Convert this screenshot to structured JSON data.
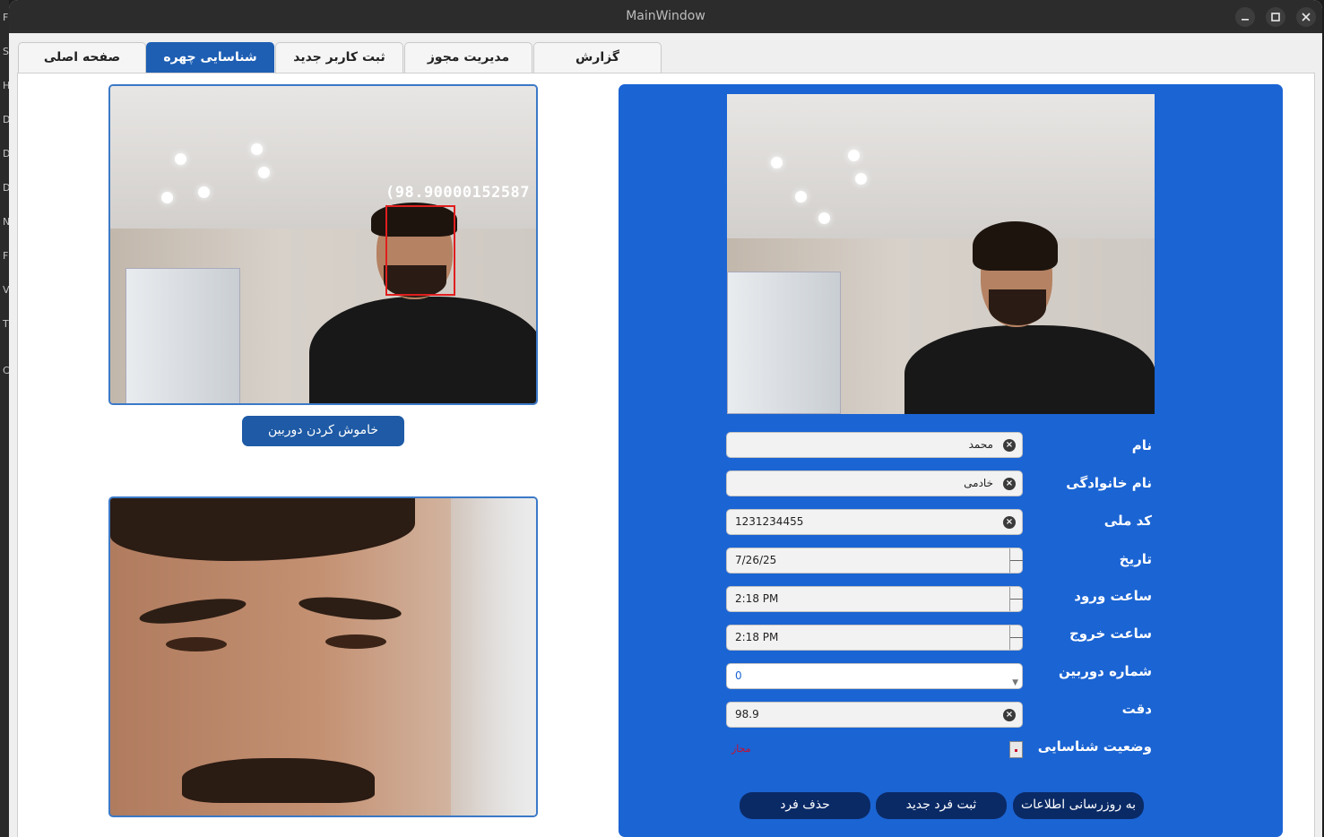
{
  "window": {
    "title": "MainWindow"
  },
  "background_letters": [
    "F",
    "S",
    "H",
    "D",
    "D",
    "D",
    "N",
    "F",
    "V",
    "T",
    "C"
  ],
  "tabs": [
    {
      "label": "صفحه اصلی",
      "active": false
    },
    {
      "label": "شناسایی چهره",
      "active": true
    },
    {
      "label": "ثبت کاربر جدید",
      "active": false
    },
    {
      "label": "مدیریت مجوز",
      "active": false
    },
    {
      "label": "گزارش",
      "active": false
    }
  ],
  "camera": {
    "overlay_text": "(98.90000152587",
    "off_button_label": "خاموش کردن دوربین"
  },
  "form": {
    "name_label": "نام",
    "name_value": "محمد",
    "family_label": "نام خانوادگی",
    "family_value": "خادمی",
    "national_code_label": "کد ملی",
    "national_code_value": "1231234455",
    "date_label": "تاریخ",
    "date_value": "7/26/25",
    "entry_time_label": "ساعت ورود",
    "entry_time_value": "2:18 PM",
    "exit_time_label": "ساعت خروج",
    "exit_time_value": "2:18 PM",
    "camera_number_label": "شماره دوربین",
    "camera_number_value": "0",
    "accuracy_label": "دقت",
    "accuracy_value": "98.9",
    "status_label": "وضعیت شناسایی",
    "status_value": "مجاز"
  },
  "actions": {
    "update_label": "به روزرسانی اطلاعات",
    "register_label": "ثبت فرد جدید",
    "delete_label": "حذف فرد"
  },
  "colors": {
    "accent": "#1b64d3",
    "active_tab": "#1e5fb4",
    "dark_button": "#0a2a66",
    "status_text": "#c8102e",
    "face_box": "#e01e1e"
  },
  "icons": {
    "clear": "clear-icon",
    "minimize": "minimize-icon",
    "maximize": "maximize-icon",
    "close": "close-icon"
  }
}
